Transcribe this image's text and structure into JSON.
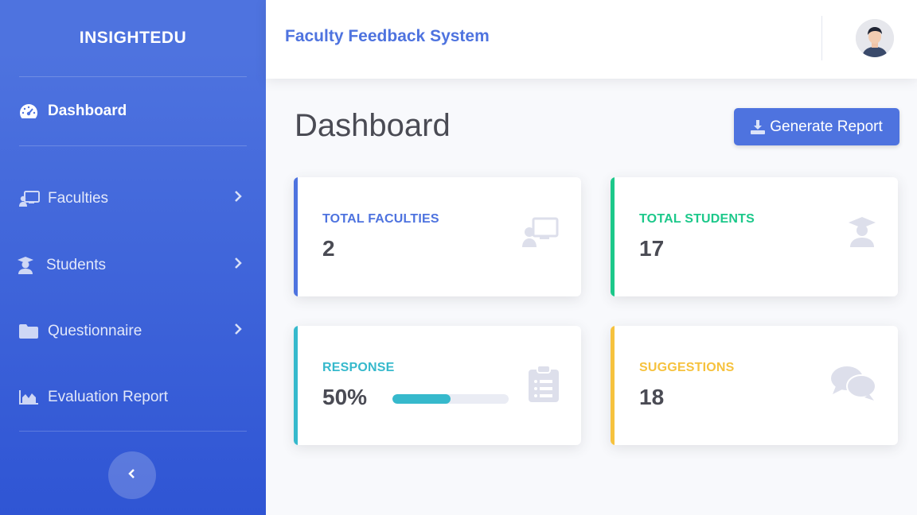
{
  "sidebar": {
    "brand": "INSIGHTEDU",
    "items": [
      {
        "label": "Dashboard",
        "icon": "tachometer-icon"
      },
      {
        "label": "Faculties",
        "icon": "chalkboard-teacher-icon"
      },
      {
        "label": "Students",
        "icon": "user-graduate-icon"
      },
      {
        "label": "Questionnaire",
        "icon": "folder-icon"
      },
      {
        "label": "Evaluation Report",
        "icon": "area-chart-icon"
      }
    ]
  },
  "topbar": {
    "title": "Faculty Feedback System"
  },
  "main": {
    "title": "Dashboard",
    "report_button": "Generate Report",
    "cards": [
      {
        "label": "TOTAL FACULTIES",
        "value": "2",
        "color": "#4e73df"
      },
      {
        "label": "TOTAL STUDENTS",
        "value": "17",
        "color": "#1cc88a"
      },
      {
        "label": "RESPONSE",
        "value": "50%",
        "color": "#36b9cc",
        "progress": 50
      },
      {
        "label": "SUGGESTIONS",
        "value": "18",
        "color": "#f6c23e"
      }
    ]
  }
}
